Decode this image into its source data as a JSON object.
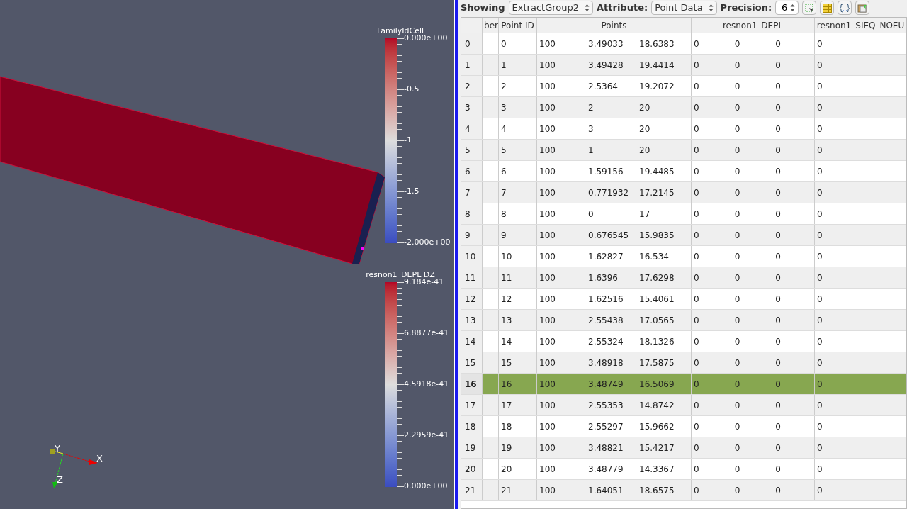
{
  "viewport": {
    "legends": [
      {
        "title": "FamilyIdCell",
        "labels": [
          "0.000e+00",
          "-0.5",
          "-1",
          "-1.5",
          "-2.000e+00"
        ]
      },
      {
        "title": "resnon1_DEPL DZ",
        "labels": [
          "9.184e-41",
          "6.8877e-41",
          "4.5918e-41",
          "2.2959e-41",
          "0.000e+00"
        ]
      }
    ],
    "axes": {
      "x": "X",
      "y": "Y",
      "z": "Z"
    }
  },
  "toolbar": {
    "showing_label": "Showing",
    "showing_value": "ExtractGroup2",
    "attribute_label": "Attribute:",
    "attribute_value": "Point Data",
    "precision_label": "Precision:",
    "precision_value": "6"
  },
  "table": {
    "columns": [
      "ber",
      "Point ID",
      "Points",
      "resnon1_DEPL",
      "resnon1_SIEQ_NOEU"
    ],
    "rows": [
      {
        "header": "0",
        "point_id": "0",
        "points": [
          "100",
          "3.49033",
          "18.6383"
        ],
        "depl": [
          "0",
          "0",
          "0"
        ],
        "sieq": "0",
        "selected": false
      },
      {
        "header": "1",
        "point_id": "1",
        "points": [
          "100",
          "3.49428",
          "19.4414"
        ],
        "depl": [
          "0",
          "0",
          "0"
        ],
        "sieq": "0",
        "selected": false
      },
      {
        "header": "2",
        "point_id": "2",
        "points": [
          "100",
          "2.5364",
          "19.2072"
        ],
        "depl": [
          "0",
          "0",
          "0"
        ],
        "sieq": "0",
        "selected": false
      },
      {
        "header": "3",
        "point_id": "3",
        "points": [
          "100",
          "2",
          "20"
        ],
        "depl": [
          "0",
          "0",
          "0"
        ],
        "sieq": "0",
        "selected": false
      },
      {
        "header": "4",
        "point_id": "4",
        "points": [
          "100",
          "3",
          "20"
        ],
        "depl": [
          "0",
          "0",
          "0"
        ],
        "sieq": "0",
        "selected": false
      },
      {
        "header": "5",
        "point_id": "5",
        "points": [
          "100",
          "1",
          "20"
        ],
        "depl": [
          "0",
          "0",
          "0"
        ],
        "sieq": "0",
        "selected": false
      },
      {
        "header": "6",
        "point_id": "6",
        "points": [
          "100",
          "1.59156",
          "19.4485"
        ],
        "depl": [
          "0",
          "0",
          "0"
        ],
        "sieq": "0",
        "selected": false
      },
      {
        "header": "7",
        "point_id": "7",
        "points": [
          "100",
          "0.771932",
          "17.2145"
        ],
        "depl": [
          "0",
          "0",
          "0"
        ],
        "sieq": "0",
        "selected": false
      },
      {
        "header": "8",
        "point_id": "8",
        "points": [
          "100",
          "0",
          "17"
        ],
        "depl": [
          "0",
          "0",
          "0"
        ],
        "sieq": "0",
        "selected": false
      },
      {
        "header": "9",
        "point_id": "9",
        "points": [
          "100",
          "0.676545",
          "15.9835"
        ],
        "depl": [
          "0",
          "0",
          "0"
        ],
        "sieq": "0",
        "selected": false
      },
      {
        "header": "10",
        "point_id": "10",
        "points": [
          "100",
          "1.62827",
          "16.534"
        ],
        "depl": [
          "0",
          "0",
          "0"
        ],
        "sieq": "0",
        "selected": false
      },
      {
        "header": "11",
        "point_id": "11",
        "points": [
          "100",
          "1.6396",
          "17.6298"
        ],
        "depl": [
          "0",
          "0",
          "0"
        ],
        "sieq": "0",
        "selected": false
      },
      {
        "header": "12",
        "point_id": "12",
        "points": [
          "100",
          "1.62516",
          "15.4061"
        ],
        "depl": [
          "0",
          "0",
          "0"
        ],
        "sieq": "0",
        "selected": false
      },
      {
        "header": "13",
        "point_id": "13",
        "points": [
          "100",
          "2.55438",
          "17.0565"
        ],
        "depl": [
          "0",
          "0",
          "0"
        ],
        "sieq": "0",
        "selected": false
      },
      {
        "header": "14",
        "point_id": "14",
        "points": [
          "100",
          "2.55324",
          "18.1326"
        ],
        "depl": [
          "0",
          "0",
          "0"
        ],
        "sieq": "0",
        "selected": false
      },
      {
        "header": "15",
        "point_id": "15",
        "points": [
          "100",
          "3.48918",
          "17.5875"
        ],
        "depl": [
          "0",
          "0",
          "0"
        ],
        "sieq": "0",
        "selected": false
      },
      {
        "header": "16",
        "point_id": "16",
        "points": [
          "100",
          "3.48749",
          "16.5069"
        ],
        "depl": [
          "0",
          "0",
          "0"
        ],
        "sieq": "0",
        "selected": true
      },
      {
        "header": "17",
        "point_id": "17",
        "points": [
          "100",
          "2.55353",
          "14.8742"
        ],
        "depl": [
          "0",
          "0",
          "0"
        ],
        "sieq": "0",
        "selected": false
      },
      {
        "header": "18",
        "point_id": "18",
        "points": [
          "100",
          "2.55297",
          "15.9662"
        ],
        "depl": [
          "0",
          "0",
          "0"
        ],
        "sieq": "0",
        "selected": false
      },
      {
        "header": "19",
        "point_id": "19",
        "points": [
          "100",
          "3.48821",
          "15.4217"
        ],
        "depl": [
          "0",
          "0",
          "0"
        ],
        "sieq": "0",
        "selected": false
      },
      {
        "header": "20",
        "point_id": "20",
        "points": [
          "100",
          "3.48779",
          "14.3367"
        ],
        "depl": [
          "0",
          "0",
          "0"
        ],
        "sieq": "0",
        "selected": false
      },
      {
        "header": "21",
        "point_id": "21",
        "points": [
          "100",
          "1.64051",
          "18.6575"
        ],
        "depl": [
          "0",
          "0",
          "0"
        ],
        "sieq": "0",
        "selected": false
      }
    ]
  }
}
